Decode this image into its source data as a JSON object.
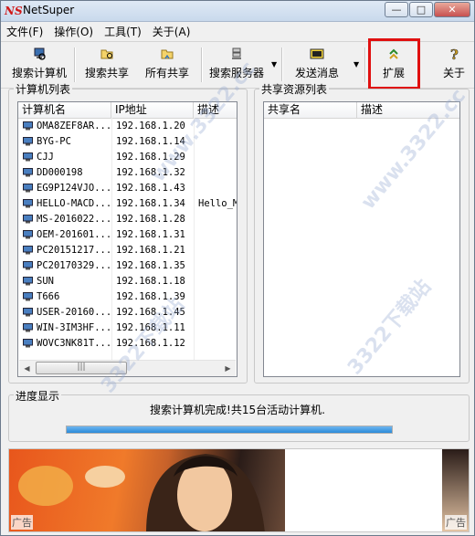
{
  "window": {
    "title": "NetSuper",
    "min_glyph": "—",
    "max_glyph": "□",
    "close_glyph": "✕"
  },
  "menu": [
    "文件(F)",
    "操作(O)",
    "工具(T)",
    "关于(A)"
  ],
  "toolbar": {
    "search_computers": "搜索计算机",
    "search_shares": "搜索共享",
    "all_shares": "所有共享",
    "search_server": "搜索服务器",
    "send_message": "发送消息",
    "expand": "扩展",
    "about": "关于"
  },
  "computer_list": {
    "group_title": "计算机列表",
    "columns": [
      "计算机名",
      "IP地址",
      "描述"
    ],
    "rows": [
      {
        "name": "OMA8ZEF8AR...",
        "ip": "192.168.1.20",
        "desc": ""
      },
      {
        "name": "BYG-PC",
        "ip": "192.168.1.14",
        "desc": ""
      },
      {
        "name": "CJJ",
        "ip": "192.168.1.29",
        "desc": ""
      },
      {
        "name": "DD000198",
        "ip": "192.168.1.32",
        "desc": ""
      },
      {
        "name": "EG9P124VJO...",
        "ip": "192.168.1.43",
        "desc": ""
      },
      {
        "name": "HELLO-MACD...",
        "ip": "192.168.1.34",
        "desc": "Hello_M"
      },
      {
        "name": "MS-2016022...",
        "ip": "192.168.1.28",
        "desc": ""
      },
      {
        "name": "OEM-201601...",
        "ip": "192.168.1.31",
        "desc": ""
      },
      {
        "name": "PC20151217...",
        "ip": "192.168.1.21",
        "desc": ""
      },
      {
        "name": "PC20170329...",
        "ip": "192.168.1.35",
        "desc": ""
      },
      {
        "name": "SUN",
        "ip": "192.168.1.18",
        "desc": ""
      },
      {
        "name": "T666",
        "ip": "192.168.1.39",
        "desc": ""
      },
      {
        "name": "USER-20160...",
        "ip": "192.168.1.45",
        "desc": ""
      },
      {
        "name": "WIN-3IM3HF...",
        "ip": "192.168.1.11",
        "desc": ""
      },
      {
        "name": "WOVC3NK81T...",
        "ip": "192.168.1.12",
        "desc": ""
      }
    ],
    "scroll_left": "◀",
    "scroll_right": "▶",
    "thumb_grip": "|||"
  },
  "share_list": {
    "group_title": "共享资源列表",
    "columns": [
      "共享名",
      "描述"
    ]
  },
  "progress": {
    "group_title": "进度显示",
    "status": "搜索计算机完成!共15台活动计算机.",
    "percent": 100
  },
  "ad": {
    "label_left": "广告",
    "label_right": "广告"
  },
  "watermark": {
    "text": "3322下载站",
    "domain": "www.3322.cc"
  },
  "colors": {
    "highlight": "#e01010",
    "progress": "#2a8ad8"
  }
}
